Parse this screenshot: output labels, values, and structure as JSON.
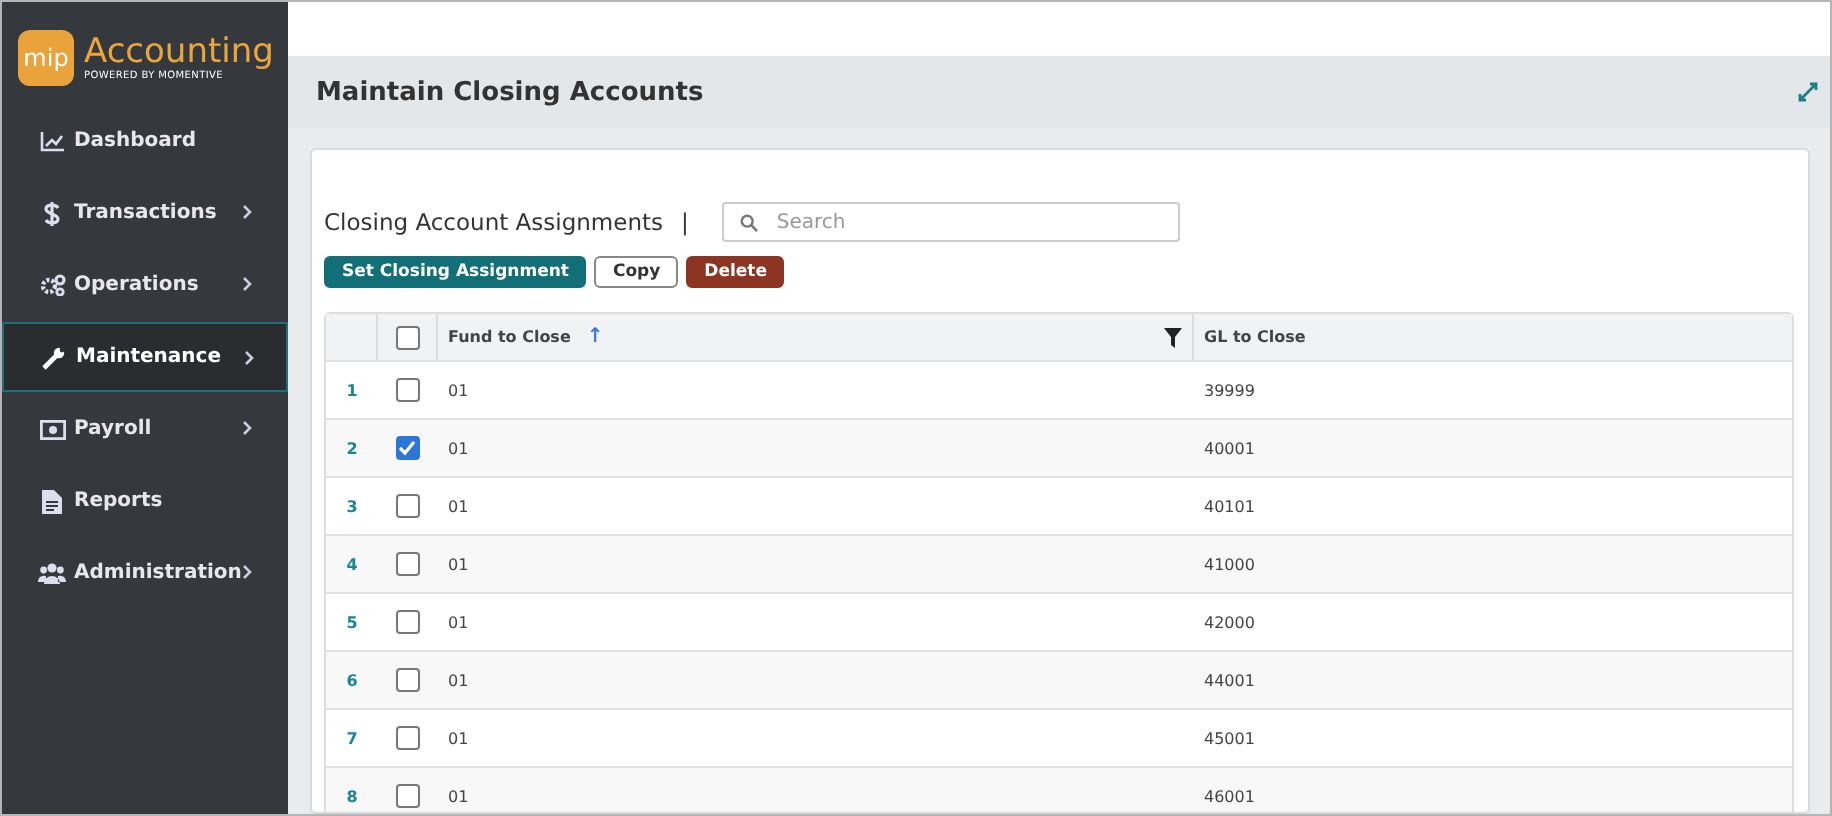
{
  "brand": {
    "logo": "mip",
    "name": "Accounting",
    "tagline": "POWERED BY MOMENTIVE"
  },
  "sidebar": {
    "items": [
      {
        "label": "Dashboard",
        "has_submenu": false,
        "selected": false
      },
      {
        "label": "Transactions",
        "has_submenu": true,
        "selected": false
      },
      {
        "label": "Operations",
        "has_submenu": true,
        "selected": false
      },
      {
        "label": "Maintenance",
        "has_submenu": true,
        "selected": true
      },
      {
        "label": "Payroll",
        "has_submenu": true,
        "selected": false
      },
      {
        "label": "Reports",
        "has_submenu": false,
        "selected": false
      },
      {
        "label": "Administration",
        "has_submenu": true,
        "selected": false
      }
    ]
  },
  "page": {
    "title": "Maintain Closing Accounts"
  },
  "section": {
    "title": "Closing Account Assignments",
    "separator": "|",
    "search": {
      "placeholder": "Search"
    }
  },
  "buttons": [
    {
      "label": "Set Closing Assignment",
      "kind": "primary"
    },
    {
      "label": "Copy",
      "kind": "secondary"
    },
    {
      "label": "Delete",
      "kind": "danger"
    }
  ],
  "table": {
    "columns": [
      {
        "label": "Fund to Close",
        "sort_icon": "↑",
        "filter": true
      },
      {
        "label": "GL to Close",
        "filter": false
      }
    ],
    "header_checked": false,
    "rows": [
      {
        "number": "1",
        "checked": false,
        "fund": "01",
        "gl": "39999"
      },
      {
        "number": "2",
        "checked": true,
        "fund": "01",
        "gl": "40001"
      },
      {
        "number": "3",
        "checked": false,
        "fund": "01",
        "gl": "40101"
      },
      {
        "number": "4",
        "checked": false,
        "fund": "01",
        "gl": "41000"
      },
      {
        "number": "5",
        "checked": false,
        "fund": "01",
        "gl": "42000"
      },
      {
        "number": "6",
        "checked": false,
        "fund": "01",
        "gl": "44001"
      },
      {
        "number": "7",
        "checked": false,
        "fund": "01",
        "gl": "45001"
      },
      {
        "number": "8",
        "checked": false,
        "fund": "01",
        "gl": "46001"
      }
    ]
  }
}
